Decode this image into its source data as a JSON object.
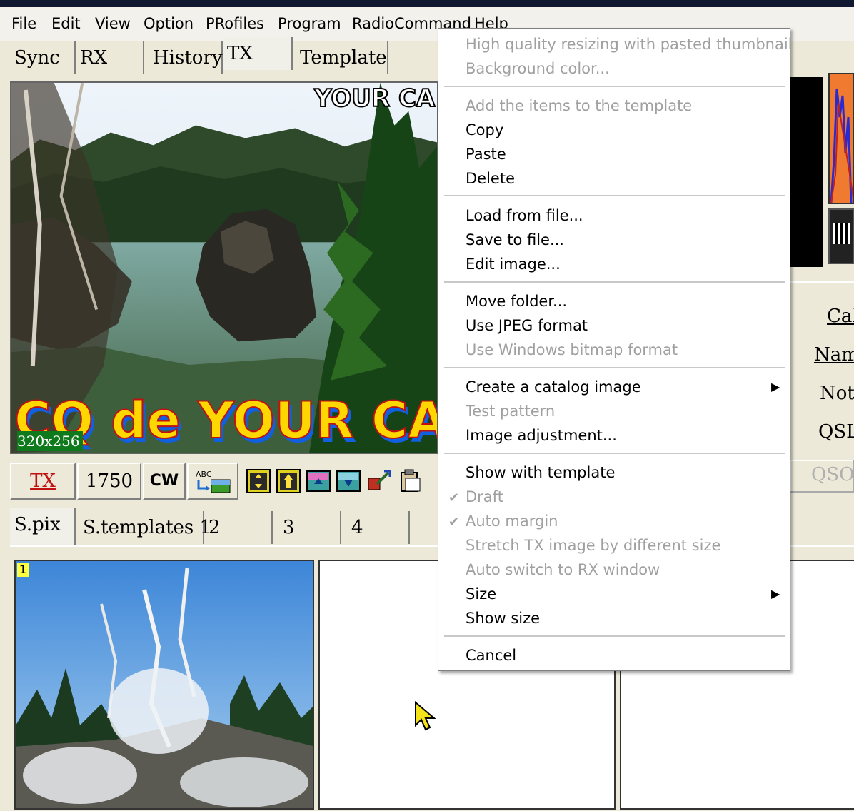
{
  "menubar": {
    "items": [
      "File",
      "Edit",
      "View",
      "Option",
      "PRofiles",
      "Program",
      "RadioCommand",
      "Help"
    ]
  },
  "top_tabs": [
    "Sync",
    "RX",
    "History",
    "TX",
    "Template"
  ],
  "image": {
    "size_badge": "320x256",
    "overlay_top": "YOUR CA",
    "overlay_bottom": "CQ de YOUR CAL"
  },
  "toolbar": {
    "tx_label": "TX",
    "freq_label": "1750",
    "cw_label": "CW",
    "abc_label": "ABC"
  },
  "right_labels": {
    "call": "Cal",
    "name": "Nam",
    "note": "Note",
    "qsl": "QSL",
    "qso": "QSO"
  },
  "bottom_tabs": [
    "S.pix",
    "S.templates 1",
    "2",
    "3",
    "4"
  ],
  "thumbnail": {
    "index": "1"
  },
  "context_menu": {
    "items": [
      {
        "label": "High quality resizing with pasted thumbnail",
        "disabled": true
      },
      {
        "label": "Background color...",
        "disabled": true
      },
      {
        "label": "Add the items to the template",
        "disabled": true
      },
      {
        "label": "Copy",
        "disabled": false
      },
      {
        "label": "Paste",
        "disabled": false
      },
      {
        "label": "Delete",
        "disabled": false
      },
      {
        "label": "Load from file...",
        "disabled": false
      },
      {
        "label": "Save to file...",
        "disabled": false
      },
      {
        "label": "Edit image...",
        "disabled": false
      },
      {
        "label": "Move folder...",
        "disabled": false
      },
      {
        "label": "Use JPEG format",
        "disabled": false
      },
      {
        "label": "Use Windows bitmap format",
        "disabled": true
      },
      {
        "label": "Create a catalog image",
        "disabled": false,
        "submenu": true
      },
      {
        "label": "Test pattern",
        "disabled": true
      },
      {
        "label": "Image adjustment...",
        "disabled": false
      },
      {
        "label": "Show with template",
        "disabled": false
      },
      {
        "label": "Draft",
        "disabled": true,
        "checked": true
      },
      {
        "label": "Auto margin",
        "disabled": true,
        "checked": true
      },
      {
        "label": "Stretch TX image by different size",
        "disabled": true
      },
      {
        "label": "Auto switch to RX window",
        "disabled": true
      },
      {
        "label": "Size",
        "disabled": false,
        "submenu": true
      },
      {
        "label": "Show size",
        "disabled": false
      },
      {
        "label": "Cancel",
        "disabled": false
      }
    ]
  },
  "colors": {
    "menu_disabled": "#a0a0a0",
    "badge_bg": "#0f7a1b",
    "overlay_text": "#ffd700",
    "tx_label": "#c01010"
  }
}
